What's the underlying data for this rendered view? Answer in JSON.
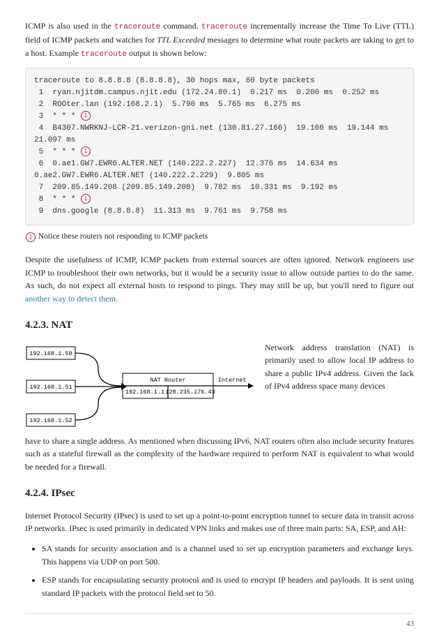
{
  "intro": {
    "pre1": "ICMP is also used in the ",
    "code1": "traceroute",
    "mid1": " command. ",
    "code2": "traceroute",
    "mid2": " incrementally increase the Time To Live (TTL) field of ICMP packets and watches for ",
    "italic": "TTL Exceeded",
    "mid3": " messages to determine what route packets are taking to get to a host. Example ",
    "code3": "traceroute",
    "post": " output is shown below:"
  },
  "traceroute": {
    "line0": "traceroute to 8.8.8.8 (8.8.8.8), 30 hops max, 60 byte packets",
    "line1": " 1  ryan.njitdm.campus.njit.edu (172.24.80.1)  0.217 ms  0.200 ms  0.252 ms",
    "line2": " 2  ROOter.lan (192.168.2.1)  5.790 ms  5.765 ms  6.275 ms",
    "line3": " 3  * * * ",
    "line4": " 4  B4307.NWRKNJ-LCR-21.verizon-gni.net (130.81.27.166)  19.166 ms  19.144 ms  21.097 ms",
    "line5": " 5  * * * ",
    "line6": " 6  0.ae1.GW7.EWR6.ALTER.NET (140.222.2.227)  12.376 ms  14.634 ms  0.ae2.GW7.EWR6.ALTER.NET (140.222.2.229)  9.805 ms",
    "line7": " 7  209.85.149.208 (209.85.149.208)  9.782 ms  10.331 ms  9.192 ms",
    "line8": " 8  * * * ",
    "line9": " 9  dns.google (8.8.8.8)  11.313 ms  9.761 ms  9.758 ms",
    "marker": "1"
  },
  "conote": {
    "marker": "1",
    "text": " Notice these routers not responding to ICMP packets"
  },
  "para2": {
    "text": "Despite the usefulness of ICMP, ICMP packets from external sources are often ignored. Network engineers use ICMP to troubleshoot their own networks, but it would be a security issue to allow outside parties to do the same. As such, do not expect all external hosts to respond to pings. They may still be up, but you'll need to figure out ",
    "link": "another way to detect them."
  },
  "nat": {
    "heading": "4.2.3. NAT",
    "host1": "192.168.1.50",
    "host2": "192.168.1.51",
    "host3": "192.168.1.52",
    "router_label": "NAT Router",
    "router_ip1": "192.168.1.1",
    "router_ip2": "128.235.176.43",
    "internet": "Internet",
    "para": "Network address translation (NAT) is primarily used to allow local IP address to share a public IPv4 address. Given the lack of IPv4 address space many devices",
    "para_continue": "have to share a single address. As mentioned when discussing IPv6, NAT routers often also include security features such as a stateful firewall as the complexity of the hardware required to perform NAT is equivalent to what would be needed for a firewall."
  },
  "ipsec": {
    "heading": "4.2.4. IPsec",
    "para1": "Internet Protocol Security (IPsec) is used to set up a point-to-point encryption tunnel to secure data in transit across IP networks. IPsec is used primarily in dedicated VPN links and makes use of three main parts: SA, ESP, and AH:",
    "bullet1": "SA stands for security association and is a channel used to set up encryption parameters and exchange keys. This happens via UDP on port 500.",
    "bullet2": "ESP stands for encapsulating security protocol and is used to encrypt IP headers and payloads. It is sent using standard IP packets with the protocol field set to 50."
  },
  "page_number": "43"
}
